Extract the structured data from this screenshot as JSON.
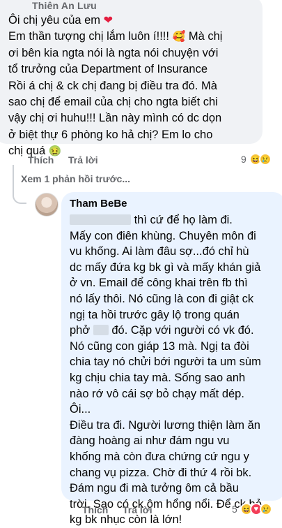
{
  "comment1": {
    "author": "Thiên An Lưu",
    "lines": [
      "Ôi chị yêu của em",
      "Em thần tượng chị lắm luôn í!!!!",
      "Mà chị",
      "ơi bên kia ngta nói là ngta nói chuyện với",
      "tổ trưởng của Department of Insurance",
      "Rồi á chị & ck chị đang bị điều tra đó. Mà",
      "sao chị để email của chị cho ngta biết chi",
      "vậy chị ơi huhu!!! Lần này mình có dc dọn",
      "ở biệt thự 6 phòng ko hả chị? Em lo cho",
      "chị quá"
    ],
    "like_label": "Thích",
    "reply_label": "Trả lời",
    "reaction_count": "9"
  },
  "view_more_label": "Xem 1 phản hồi trước...",
  "comment2": {
    "author": "Tham BeBe",
    "lines": [
      "thì cứ để họ làm đi.",
      "Mấy con điên khùng. Chuyên môn đi",
      "vu khống. Ai làm đâu sợ...đó chỉ hù",
      "dc mấy đứa kg bk gì và mấy khán giả",
      "ở vn. Email để công khai trên fb thì",
      "nó lấy thôi. Nó cũng là con đi giật ck",
      "ngị ta hồi trước gây lộ trong quán",
      "phở",
      "đó. Cặp với người có vk đó.",
      "Nó cũng con giáp 13 mà. Ngị ta đòi",
      "chia tay nó chửi bới người ta um sùm",
      "kg chịu chia tay mà. Sống sao anh",
      "nào rớ vô cái sợ bỏ chạy mất dép.",
      "Ôi...",
      "Điều tra đi. Người lương thiện làm ăn",
      "đàng hoàng ai như đám ngu vu",
      "khống mà còn đưa chứng cứ ngu y",
      "chang vụ pizza. Chờ đi thứ 4 rồi bk.",
      "Đám ngu đi mà tưởng ôm cả bầu",
      "trời. Sao có ck ôm hổng nổi. Để ck bỏ",
      "kg bk nhục còn là lớn!"
    ],
    "like_label": "Thích",
    "reply_label": "Trả lời",
    "reaction_count": "5"
  },
  "colors": {
    "bubble1": "#f0f2f5",
    "bubble2": "#eaf3ff",
    "meta": "#65676b",
    "heart": "#e41e3f"
  }
}
